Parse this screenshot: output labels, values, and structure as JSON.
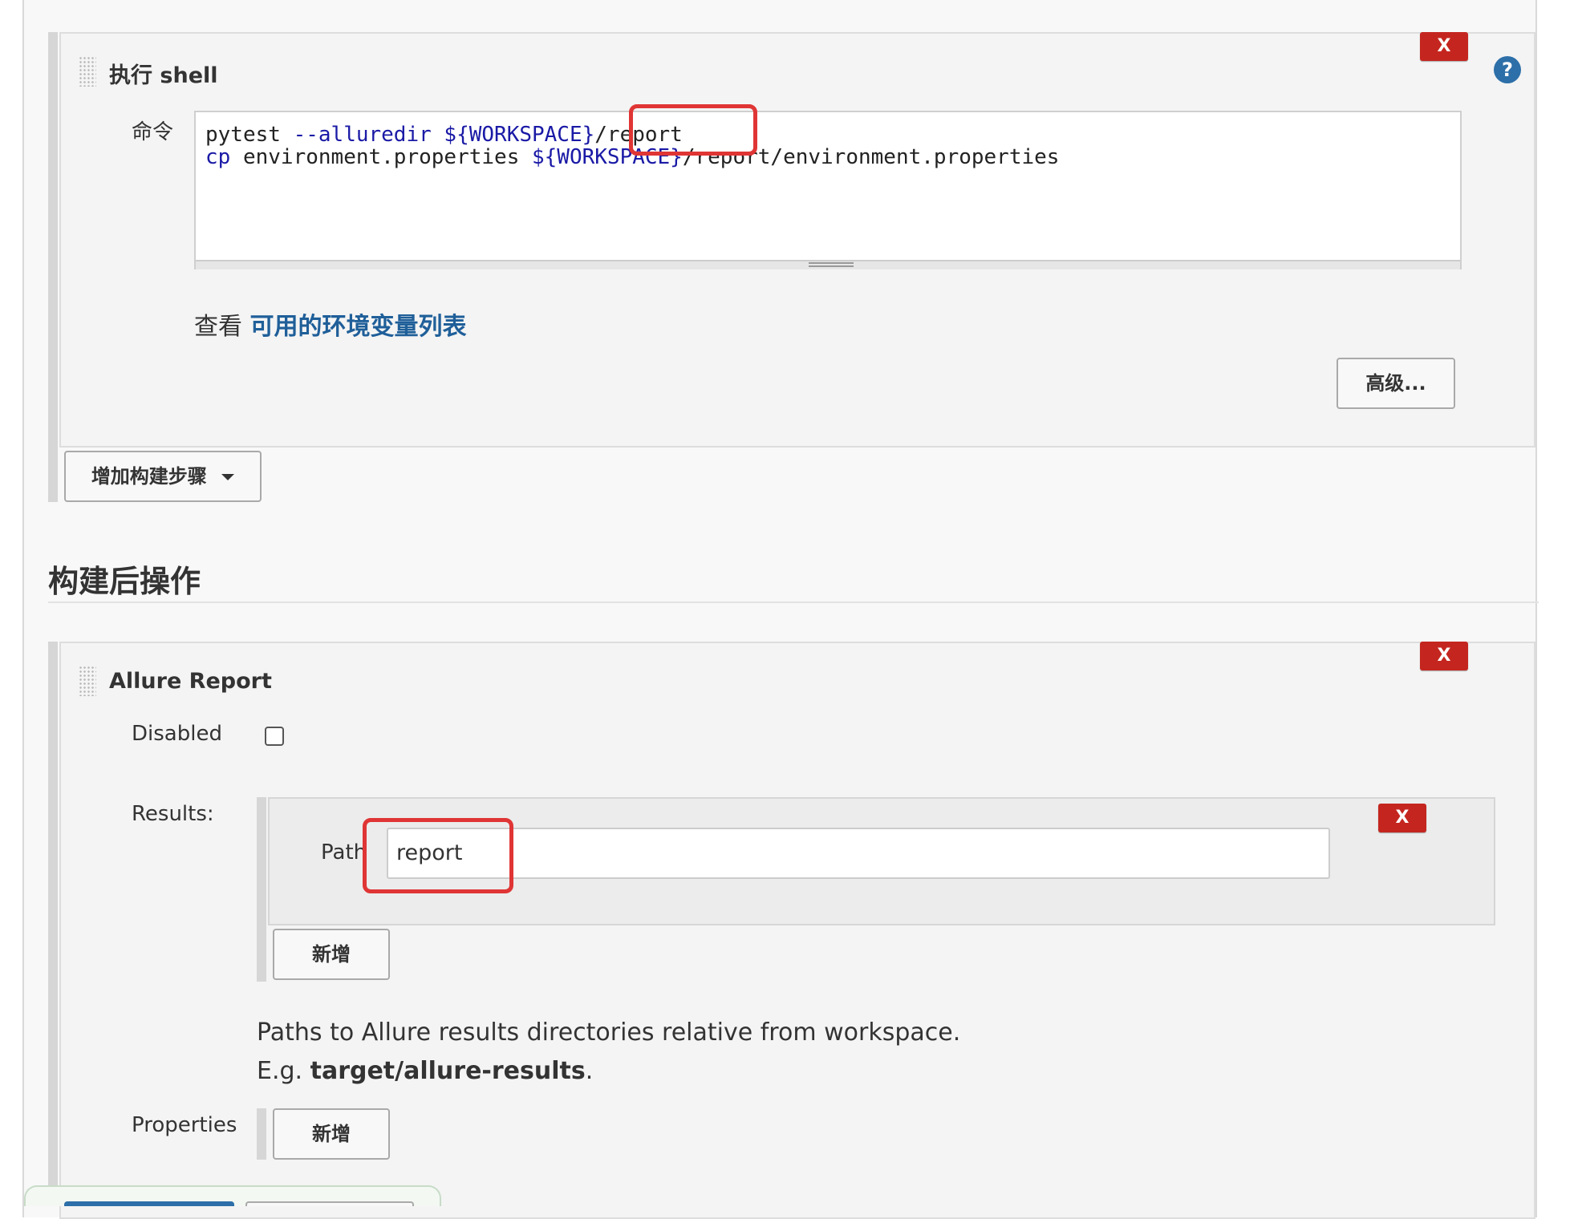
{
  "colors": {
    "accent_blue": "#2d6fa8",
    "link_blue": "#1f5f99",
    "danger_red": "#c4261f",
    "highlight_red": "#e03535",
    "primary_save_blue": "#2d6fa8"
  },
  "shell_step": {
    "title": "执行 shell",
    "close_label": "X",
    "help_icon": "?",
    "command_label": "命令",
    "command_lines": [
      {
        "cmd": "pytest",
        "flag": "--alluredir",
        "var": "${WORKSPACE}",
        "rest": "/report"
      },
      {
        "cmd": "cp",
        "arg": "environment.properties",
        "var": "${WORKSPACE}",
        "rest": "/report/environment.properties"
      }
    ],
    "env_prefix": "查看",
    "env_link": "可用的环境变量列表",
    "advanced_button": "高级..."
  },
  "add_build_step_button": "增加构建步骤",
  "post_build": {
    "heading": "构建后操作"
  },
  "allure": {
    "title": "Allure Report",
    "close_label": "X",
    "disabled_label": "Disabled",
    "disabled_checked": false,
    "results_label": "Results:",
    "path_label": "Path",
    "path_value": "report",
    "path_close_label": "X",
    "add_result_button": "新增",
    "help_line1": "Paths to Allure results directories relative from workspace.",
    "help_line2_prefix": "E.g. ",
    "help_line2_bold": "target/allure-results",
    "help_line2_suffix": ".",
    "properties_label": "Properties",
    "add_property_button": "新增"
  }
}
